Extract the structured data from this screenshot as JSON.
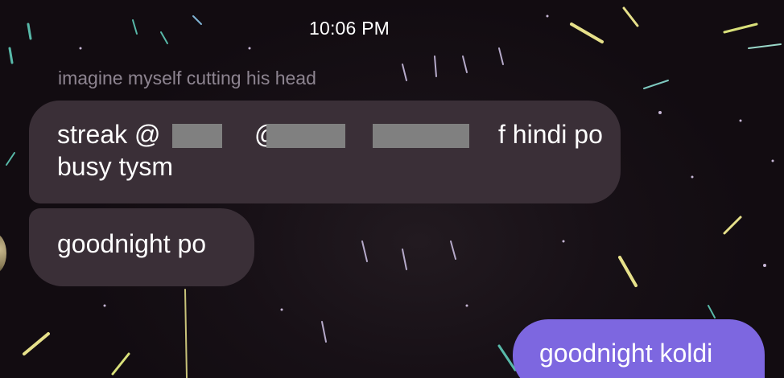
{
  "status_bar": {
    "time": "10:06 PM"
  },
  "messages": {
    "reply_preview": "imagine myself cutting his head",
    "msg1_line1": "streak @",
    "msg1_mid1": "@",
    "msg1_mid2": "@",
    "msg1_end": "f hindi po",
    "msg1_line2": "busy tysm",
    "msg2": "goodnight po",
    "msg3": "goodnight koldi"
  },
  "colors": {
    "incoming_bubble": "#3a2f37",
    "outgoing_bubble": "#7d67e0",
    "background": "#150f14"
  }
}
